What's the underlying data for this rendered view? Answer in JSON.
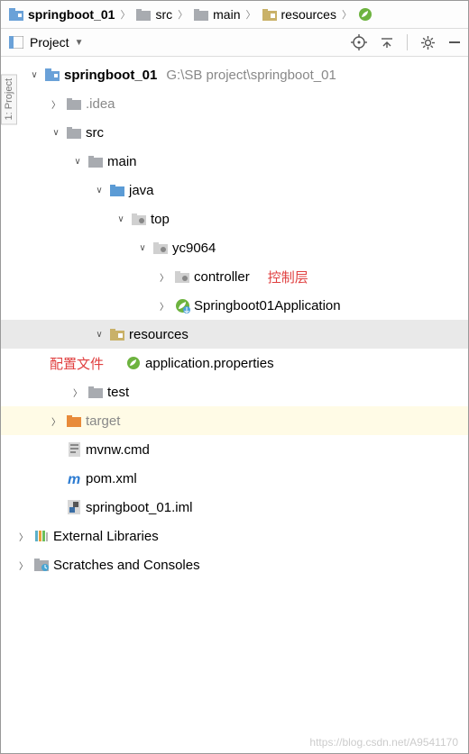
{
  "breadcrumb": {
    "items": [
      {
        "label": "springboot_01",
        "icon": "module",
        "bold": true
      },
      {
        "label": "src",
        "icon": "folder"
      },
      {
        "label": "main",
        "icon": "folder"
      },
      {
        "label": "resources",
        "icon": "resources"
      }
    ]
  },
  "toolheader": {
    "view_label": "Project"
  },
  "side_tab": "1: Project",
  "tree": {
    "root": {
      "name": "springboot_01",
      "path": "G:\\SB project\\springboot_01"
    },
    "idea": ".idea",
    "src": "src",
    "main": "main",
    "java": "java",
    "top": "top",
    "yc": "yc9064",
    "controller": "controller",
    "controller_note": "控制层",
    "app_class": "Springboot01Application",
    "resources": "resources",
    "app_props": "application.properties",
    "props_note": "配置文件",
    "test": "test",
    "target": "target",
    "mvnw": "mvnw.cmd",
    "pom": "pom.xml",
    "iml": "springboot_01.iml",
    "ext_lib": "External Libraries",
    "scratches": "Scratches and Consoles"
  },
  "watermark": "https://blog.csdn.net/A9541170"
}
